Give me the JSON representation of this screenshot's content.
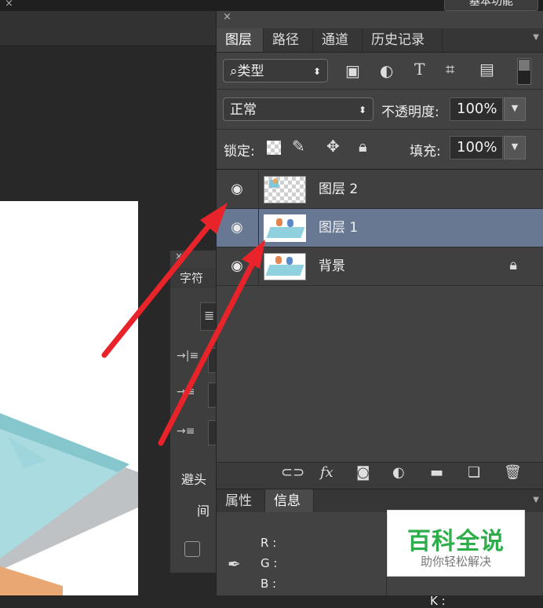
{
  "workspace": {
    "label": "基本功能"
  },
  "layers_panel": {
    "close": "×",
    "tabs": [
      {
        "label": "图层",
        "active": true
      },
      {
        "label": "路径",
        "active": false
      },
      {
        "label": "通道",
        "active": false
      },
      {
        "label": "历史记录",
        "active": false
      }
    ],
    "filter": {
      "label": "⌕类型",
      "arrow": "⬍"
    },
    "filter_icons": [
      "image-filter-icon",
      "adjustment-filter-icon",
      "type-filter-icon",
      "shape-filter-icon",
      "smart-object-filter-icon",
      "filter-toggle-icon"
    ],
    "blend_mode": {
      "label": "正常",
      "arrow": "⬍"
    },
    "opacity": {
      "label": "不透明度:",
      "value": "100%"
    },
    "lock": {
      "label": "锁定:"
    },
    "fill": {
      "label": "填充:",
      "value": "100%"
    },
    "layers": [
      {
        "name": "图层 2",
        "visible": true,
        "selected": false,
        "locked": false,
        "thumb": "transparent"
      },
      {
        "name": "图层 1",
        "visible": true,
        "selected": true,
        "locked": false,
        "thumb": "image"
      },
      {
        "name": "背景",
        "visible": true,
        "selected": false,
        "locked": true,
        "thumb": "image"
      }
    ],
    "bottom_icons": [
      "link-layers-icon",
      "fx-icon",
      "add-mask-icon",
      "new-adjustment-icon",
      "new-group-icon",
      "new-layer-icon",
      "delete-layer-icon"
    ]
  },
  "info_panel": {
    "tabs": [
      {
        "label": "属性",
        "active": false
      },
      {
        "label": "信息",
        "active": true
      }
    ],
    "channels": [
      "R :",
      "G :",
      "B :"
    ],
    "extra": "K :"
  },
  "character_panel": {
    "close": "×",
    "tab": "字符",
    "avoid_label": "避头",
    "spacing_label": "间"
  },
  "watermark": {
    "title": "百科全说",
    "subtitle": "助你轻松解决"
  },
  "annotation_color": "#e8232a"
}
